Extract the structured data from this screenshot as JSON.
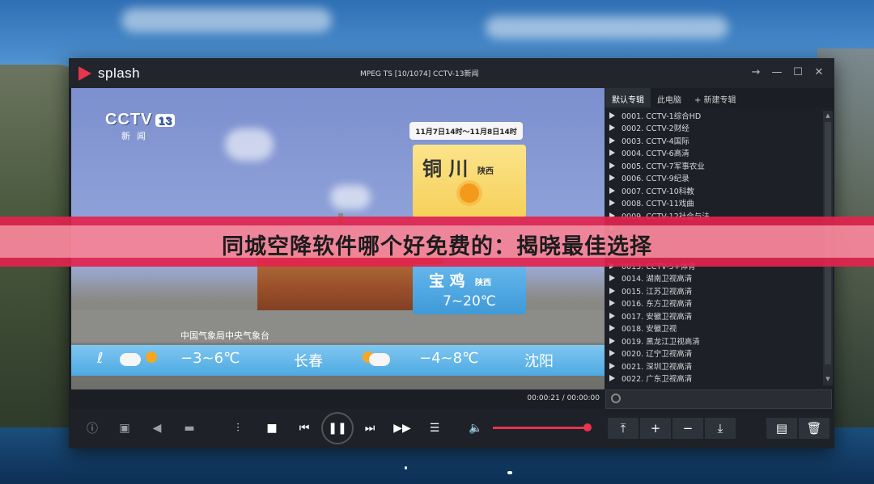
{
  "app": {
    "logo_text": "splash",
    "title": "MPEG TS   [10/1074] CCTV-13新闻",
    "window_controls": [
      "→",
      "—",
      "☐",
      "✕"
    ]
  },
  "video": {
    "channel_logo": "CCTV",
    "channel_number": "13",
    "channel_sub": "新闻",
    "weather_date": "11月7日14时～11月8日14时",
    "city1": "铜 川",
    "province1": "陕西",
    "city2": "宝 鸡",
    "province2": "陕西",
    "temp2": "7~20℃",
    "caption": "中国气象局中央气象台",
    "ticker": {
      "left_fragment": "ℓ",
      "temp_a": "−3~6℃",
      "city_a": "长春",
      "temp_b": "−4~8℃",
      "city_b": "沈阳"
    }
  },
  "playlist": {
    "tabs": [
      "默认专辑",
      "此电脑",
      "+ 新建专辑"
    ],
    "items": [
      "0001. CCTV-1综合HD",
      "0002. CCTV-2财经",
      "0003. CCTV-4国际",
      "0004. CCTV-6高清",
      "0005. CCTV-7军事农业",
      "0006. CCTV-9纪录",
      "0007. CCTV-10科教",
      "0008. CCTV-11戏曲",
      "0009. CCTV-12社会与法",
      "",
      "",
      "",
      "0013. CCTV-5+体育",
      "0014. 湖南卫视高清",
      "0015. 江苏卫视高清",
      "0016. 东方卫视高清",
      "0017. 安徽卫视高清",
      "0018. 安徽卫视",
      "0019. 黑龙江卫视高清",
      "0020. 辽宁卫视高清",
      "0021. 深圳卫视高清",
      "0022. 广东卫视高清"
    ]
  },
  "player": {
    "time": "00:00:21  /  00:00:00",
    "volume_level": 0.95
  },
  "banner": {
    "text": "同城空降软件哪个好免费的：揭晓最佳选择"
  },
  "colors": {
    "accent": "#e8344c",
    "banner": "#e2244e"
  }
}
